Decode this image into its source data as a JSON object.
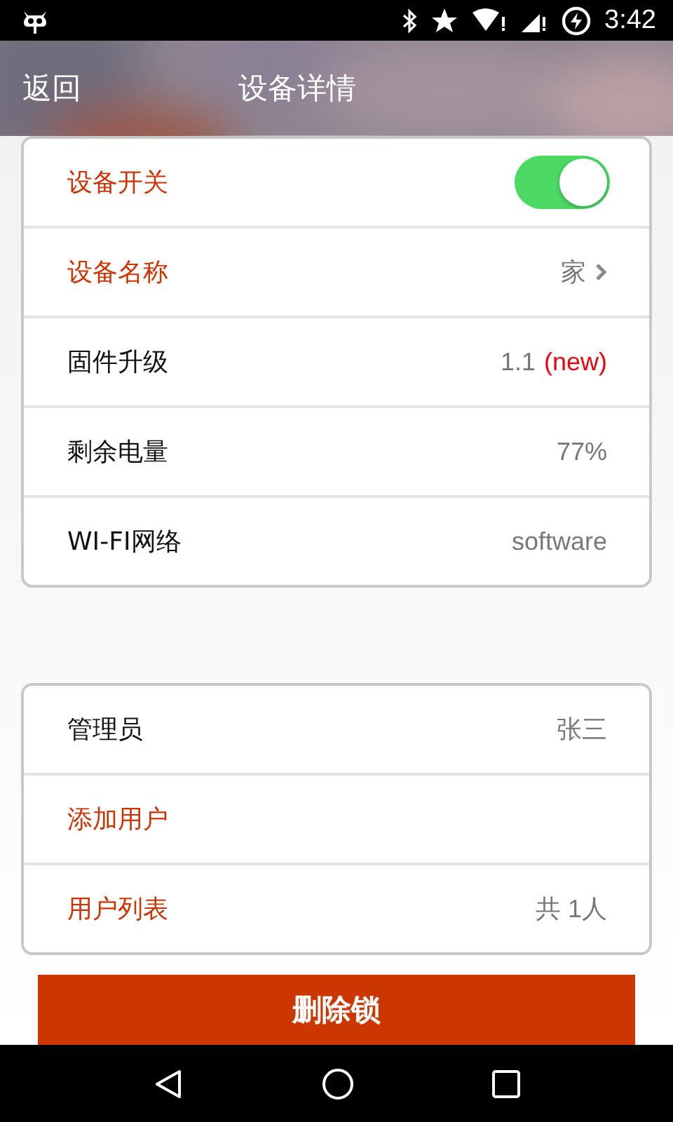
{
  "status_bar": {
    "time": "3:42"
  },
  "header": {
    "back": "返回",
    "title": "设备详情"
  },
  "sections": [
    {
      "rows": [
        {
          "kind": "toggle",
          "label": "设备开关",
          "accent": true,
          "on": true
        },
        {
          "kind": "link",
          "label": "设备名称",
          "accent": true,
          "value": "家"
        },
        {
          "kind": "value",
          "label": "固件升级",
          "accent": false,
          "value": "1.1",
          "tag": "(new)"
        },
        {
          "kind": "value",
          "label": "剩余电量",
          "accent": false,
          "value": "77%"
        },
        {
          "kind": "value",
          "label": "WI-FI网络",
          "accent": false,
          "value": "software"
        }
      ]
    },
    {
      "rows": [
        {
          "kind": "value",
          "label": "管理员",
          "accent": false,
          "value": "张三"
        },
        {
          "kind": "action",
          "label": "添加用户",
          "accent": true
        },
        {
          "kind": "value",
          "label": "用户列表",
          "accent": true,
          "value": "共 1人"
        }
      ]
    }
  ],
  "delete_button": "删除锁"
}
